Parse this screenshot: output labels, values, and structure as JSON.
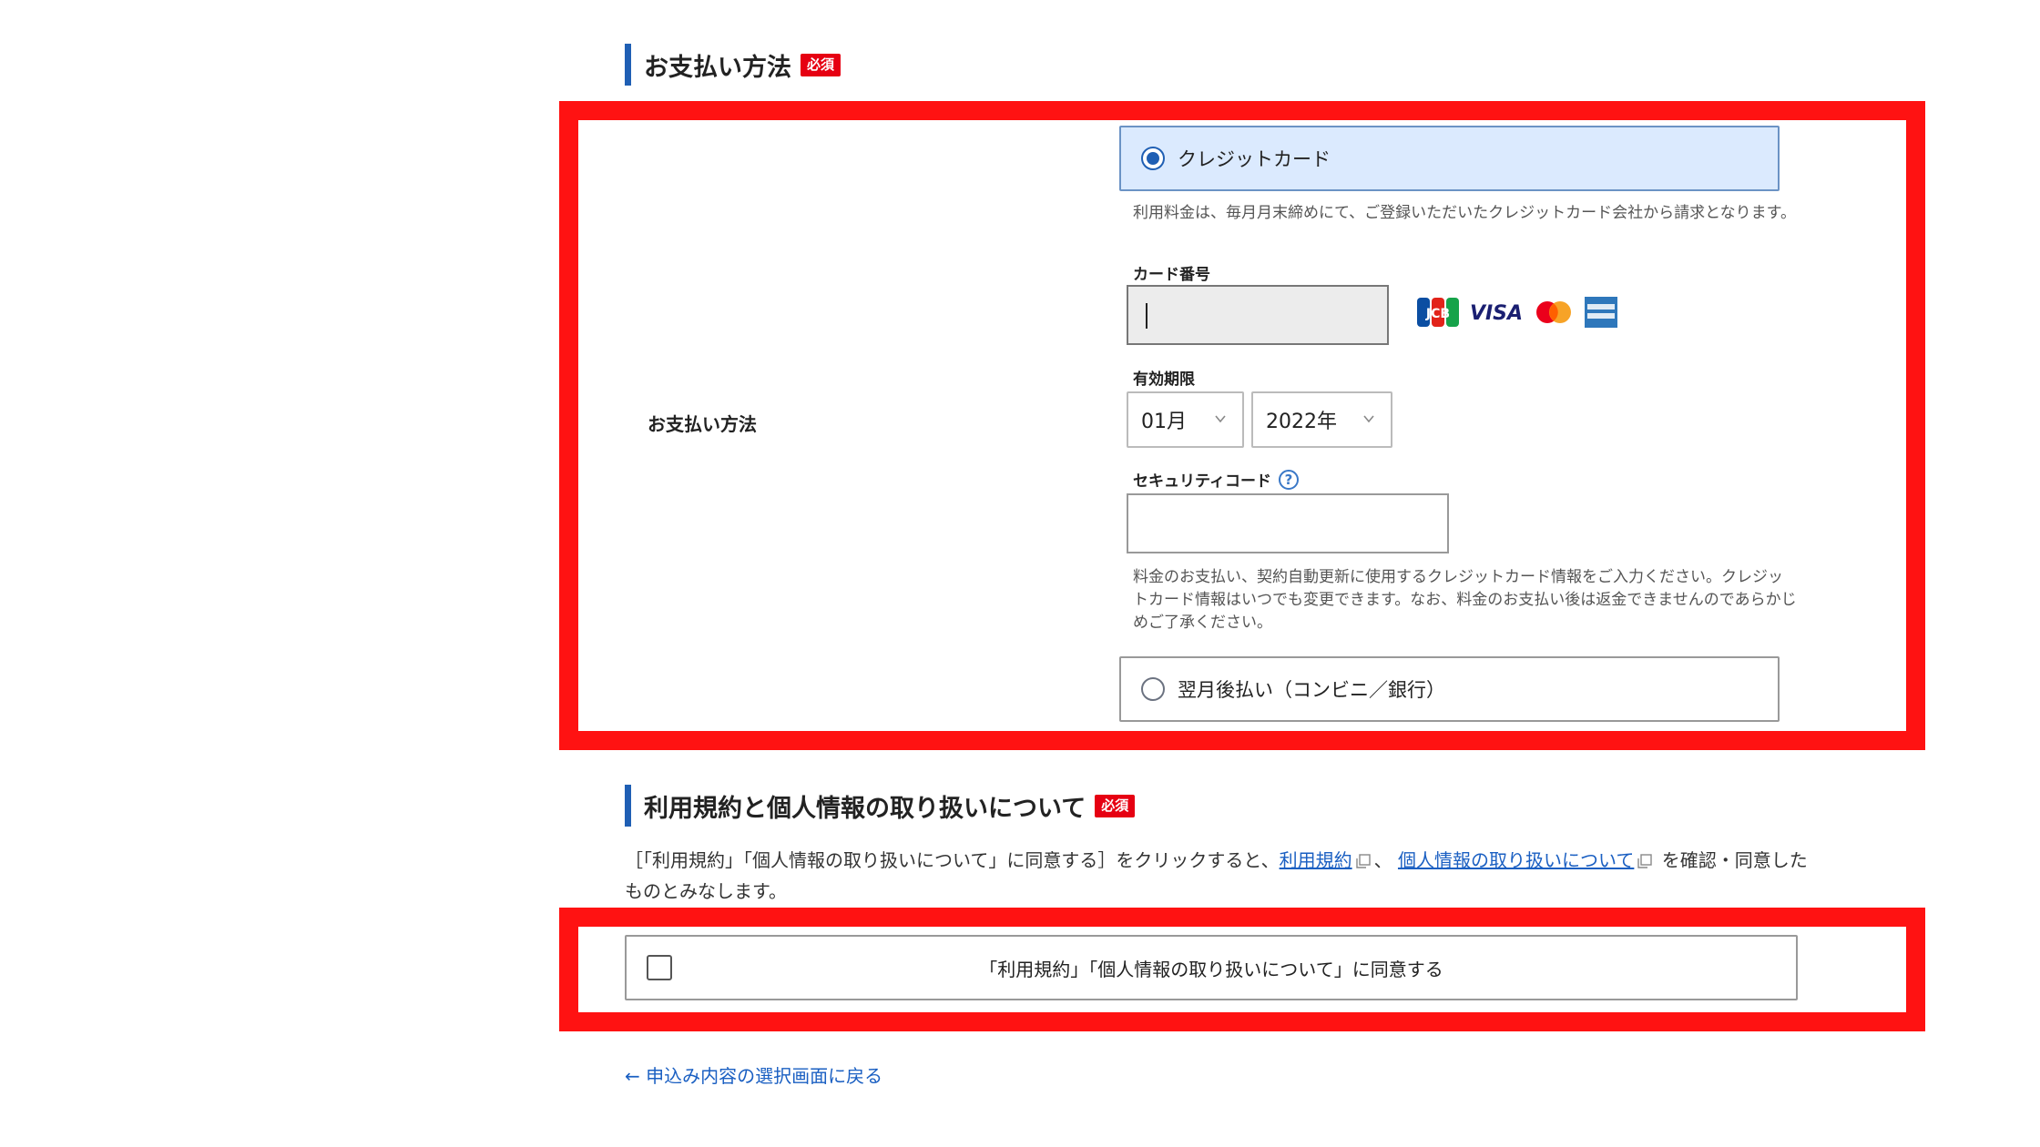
{
  "payment": {
    "section_title": "お支払い方法",
    "required_badge": "必須",
    "row_label": "お支払い方法",
    "credit_option": {
      "label": "クレジットカード",
      "selected": true,
      "note": "利用料金は、毎月月末締めにて、ご登録いただいたクレジットカード会社から請求となります。"
    },
    "card_number": {
      "label": "カード番号",
      "value": ""
    },
    "card_brands": [
      "JCB",
      "VISA",
      "Mastercard",
      "AMEX"
    ],
    "expiry": {
      "label": "有効期限",
      "month": "01月",
      "year": "2022年"
    },
    "security_code": {
      "label": "セキュリティコード",
      "help": "?",
      "value": ""
    },
    "info_note": "料金のお支払い、契約自動更新に使用するクレジットカード情報をご入力ください。クレジットカード情報はいつでも変更できます。なお、料金のお支払い後は返金できませんのであらかじめご了承ください。",
    "deferred_option": {
      "label": "翌月後払い（コンビニ／銀行）",
      "selected": false
    }
  },
  "terms": {
    "section_title": "利用規約と個人情報の取り扱いについて",
    "required_badge": "必須",
    "text_before": "［「利用規約」「個人情報の取り扱いについて」に同意する］をクリックすると、",
    "link_terms": "利用規約",
    "separator": "、",
    "link_privacy": "個人情報の取り扱いについて",
    "text_after": "を確認・同意したものとみなします。",
    "agree_label": "「利用規約」「個人情報の取り扱いについて」に同意する",
    "agree_checked": false
  },
  "back_link": "← 申込み内容の選択画面に戻る",
  "colors": {
    "accent": "#1f5fb4",
    "highlight": "#ff1212",
    "required": "#e60012",
    "link": "#1a5fc2"
  }
}
